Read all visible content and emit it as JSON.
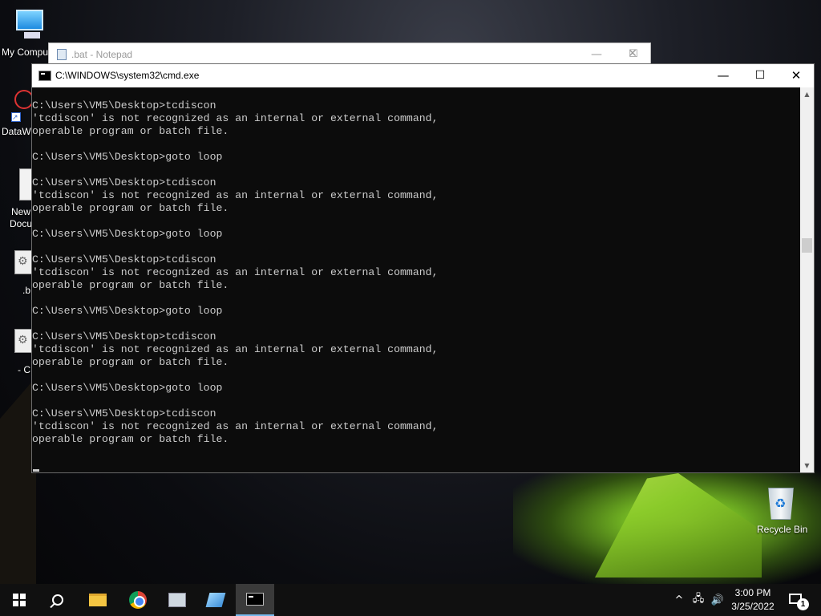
{
  "desktop": {
    "icons": {
      "computer": "My Compu",
      "data": "DataW",
      "doc_line1": "New",
      "doc_line2": "Docu",
      "bat": ".b",
      "bat2": "- C",
      "recycle": "Recycle Bin"
    }
  },
  "notepad": {
    "title": ".bat - Notepad",
    "minimize": "—",
    "maximize": "☐",
    "close": "✕"
  },
  "cmd": {
    "title": "C:\\WINDOWS\\system32\\cmd.exe",
    "minimize": "—",
    "maximize": "☐",
    "close": "✕",
    "lines": [
      "C:\\Users\\VM5\\Desktop>tcdiscon",
      "'tcdiscon' is not recognized as an internal or external command,",
      "operable program or batch file.",
      "",
      "C:\\Users\\VM5\\Desktop>goto loop",
      "",
      "C:\\Users\\VM5\\Desktop>tcdiscon",
      "'tcdiscon' is not recognized as an internal or external command,",
      "operable program or batch file.",
      "",
      "C:\\Users\\VM5\\Desktop>goto loop",
      "",
      "C:\\Users\\VM5\\Desktop>tcdiscon",
      "'tcdiscon' is not recognized as an internal or external command,",
      "operable program or batch file.",
      "",
      "C:\\Users\\VM5\\Desktop>goto loop",
      "",
      "C:\\Users\\VM5\\Desktop>tcdiscon",
      "'tcdiscon' is not recognized as an internal or external command,",
      "operable program or batch file.",
      "",
      "C:\\Users\\VM5\\Desktop>goto loop",
      "",
      "C:\\Users\\VM5\\Desktop>tcdiscon",
      "'tcdiscon' is not recognized as an internal or external command,",
      "operable program or batch file."
    ],
    "scroll_up": "▲",
    "scroll_down": "▼"
  },
  "taskbar": {
    "items": [
      "start-icon",
      "search-icon",
      "file-explorer-icon",
      "chrome-icon",
      "network-app-icon",
      "notes-app-icon",
      "cmd-icon"
    ],
    "tray": {
      "chevron": "^",
      "network": "🖧",
      "volume": "🔊"
    },
    "time": "3:00 PM",
    "date": "3/25/2022",
    "notification_count": "1"
  },
  "colors": {
    "console_bg": "#0c0c0c",
    "console_fg": "#cccccc",
    "taskbar_bg": "#101010",
    "accent": "#76b9ed"
  }
}
